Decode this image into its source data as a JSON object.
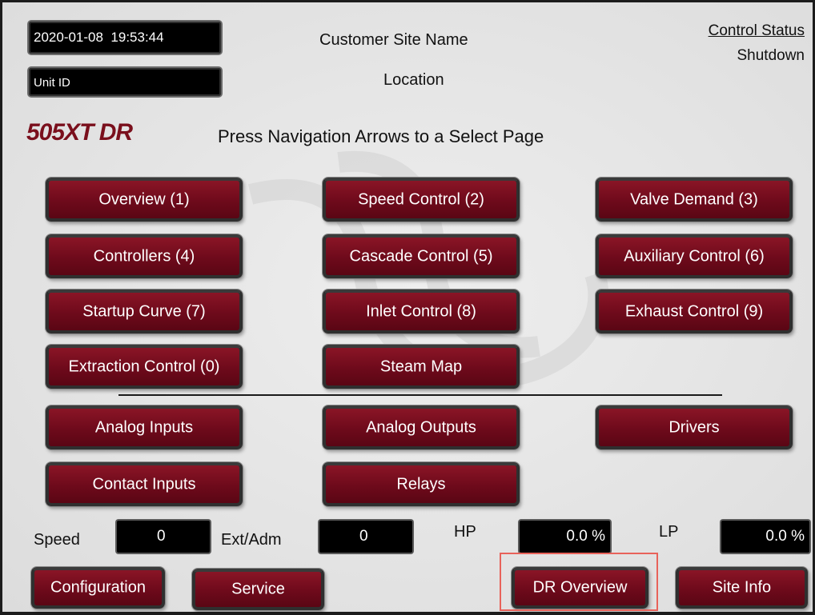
{
  "header": {
    "datetime": "2020-01-08  19:53:44",
    "unit_id": "Unit ID",
    "site_name": "Customer Site Name",
    "location": "Location",
    "control_status_label": "Control Status",
    "control_status_value": "Shutdown",
    "brand": "505XT DR",
    "instruction": "Press Navigation Arrows to a Select Page"
  },
  "nav": {
    "overview": "Overview (1)",
    "speed_control": "Speed Control (2)",
    "valve_demand": "Valve Demand (3)",
    "controllers": "Controllers (4)",
    "cascade_control": "Cascade Control (5)",
    "auxiliary_control": "Auxiliary Control (6)",
    "startup_curve": "Startup Curve (7)",
    "inlet_control": "Inlet Control (8)",
    "exhaust_control": "Exhaust Control (9)",
    "extraction_control": "Extraction Control (0)",
    "steam_map": "Steam Map",
    "analog_inputs": "Analog Inputs",
    "analog_outputs": "Analog Outputs",
    "drivers": "Drivers",
    "contact_inputs": "Contact Inputs",
    "relays": "Relays"
  },
  "readouts": {
    "speed_label": "Speed",
    "speed_value": "0",
    "extadm_label": "Ext/Adm",
    "extadm_value": "0",
    "hp_label": "HP",
    "hp_value": "0.0 %",
    "lp_label": "LP",
    "lp_value": "0.0 %"
  },
  "footer": {
    "configuration": "Configuration",
    "service": "Service",
    "dr_overview": "DR Overview",
    "site_info": "Site Info"
  },
  "colors": {
    "button": "#6e0a1b",
    "brand": "#7a0f1c",
    "highlight": "#e8625a"
  }
}
